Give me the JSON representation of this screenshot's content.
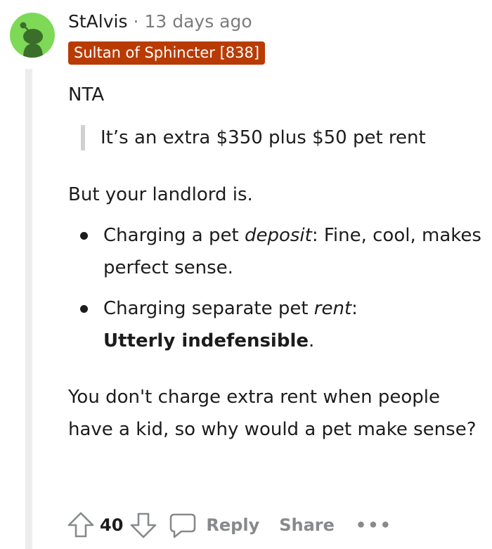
{
  "comment": {
    "username": "StAlvis",
    "separator": "·",
    "timestamp": "13 days ago",
    "flair": {
      "text": "Sultan of Sphincter [838]",
      "bg_color": "#b93b04"
    },
    "avatar": {
      "icon": "snoo-avatar-icon",
      "bg_color": "#7ed957",
      "figure_color": "#3b6e2b"
    },
    "body": {
      "p1": "NTA",
      "quote": "It’s an extra $350 plus $50 pet rent",
      "p2": "But your landlord is.",
      "bullets": [
        {
          "prefix": "Charging a pet ",
          "emph": "deposit",
          "suffix": ": Fine, cool, makes perfect sense."
        },
        {
          "prefix": "Charging separate pet ",
          "emph": "rent",
          "mid": ": ",
          "strong": "Utterly indefensible",
          "suffix": "."
        }
      ],
      "p3": "You don't charge extra rent when people have a kid, so why would a pet make sense?"
    },
    "actions": {
      "vote_count": "40",
      "reply_label": "Reply",
      "share_label": "Share",
      "more_label": "•••",
      "icons": {
        "upvote": "upvote-icon",
        "downvote": "downvote-icon",
        "reply": "comment-bubble-icon"
      }
    }
  }
}
